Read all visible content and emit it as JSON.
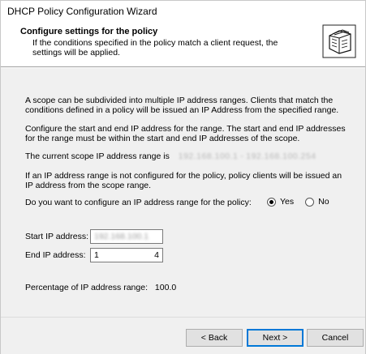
{
  "window": {
    "title": "DHCP Policy Configuration Wizard"
  },
  "header": {
    "title": "Configure settings for the policy",
    "subtitle": "If the conditions specified in the policy match a client request, the settings will be applied.",
    "icon": "folder-documents-icon"
  },
  "body": {
    "para1": "A scope can be subdivided into multiple IP address ranges. Clients that match the conditions defined in a policy will be issued an IP Address from the specified range.",
    "para2": "Configure the start and end IP address for the range. The start and end IP addresses for the range must be within the start and end IP addresses of the scope.",
    "scope_range_label": "The current scope IP address range is",
    "scope_range_start": "192.168.100.1",
    "scope_range_sep": "-",
    "scope_range_end": "192.168.100.254",
    "para4": "If an IP address range is not configured for the policy, policy clients will be issued an IP address from the scope range.",
    "question": "Do you want to configure an IP address range for the policy:",
    "radio_yes": "Yes",
    "radio_no": "No",
    "selected": "Yes",
    "start_label": "Start IP address:",
    "start_value": "192.168.100.1",
    "end_label": "End IP address:",
    "end_value_start": "1",
    "end_value_end": "4",
    "percentage_label": "Percentage of IP address range:",
    "percentage_value": "100.0"
  },
  "footer": {
    "back": "< Back",
    "next": "Next >",
    "cancel": "Cancel"
  }
}
